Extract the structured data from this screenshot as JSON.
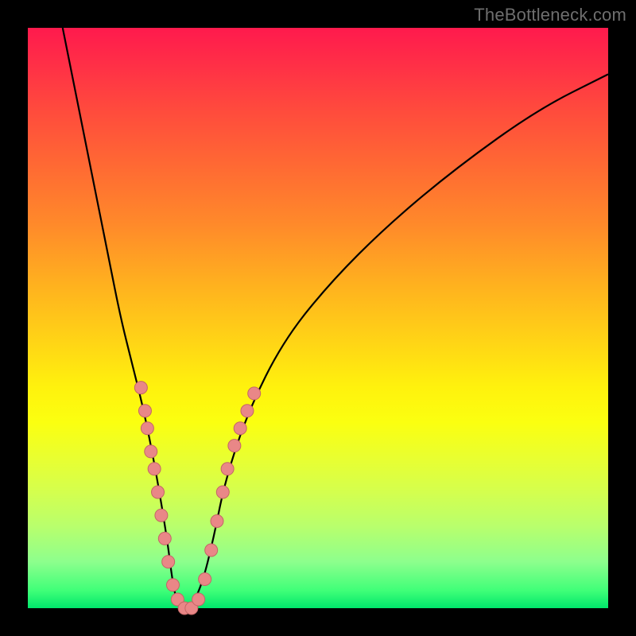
{
  "watermark": "TheBottleneck.com",
  "colors": {
    "background": "#000000",
    "curve": "#000000",
    "dot_fill": "#e98787",
    "dot_stroke": "#c46666"
  },
  "chart_data": {
    "type": "line",
    "title": "",
    "xlabel": "",
    "ylabel": "",
    "xlim": [
      0,
      100
    ],
    "ylim": [
      0,
      100
    ],
    "grid": false,
    "legend": false,
    "series": [
      {
        "name": "bottleneck-curve",
        "x": [
          6,
          8,
          10,
          12,
          14,
          16,
          18,
          20,
          22,
          24,
          25,
          26,
          28,
          30,
          32,
          34,
          38,
          44,
          52,
          62,
          74,
          88,
          100
        ],
        "values": [
          100,
          90,
          80,
          70,
          60,
          50,
          42,
          34,
          24,
          12,
          4,
          0,
          0,
          4,
          12,
          22,
          34,
          46,
          56,
          66,
          76,
          86,
          92
        ]
      }
    ],
    "dots": [
      {
        "x": 19.5,
        "y": 38
      },
      {
        "x": 20.2,
        "y": 34
      },
      {
        "x": 20.6,
        "y": 31
      },
      {
        "x": 21.2,
        "y": 27
      },
      {
        "x": 21.8,
        "y": 24
      },
      {
        "x": 22.4,
        "y": 20
      },
      {
        "x": 23.0,
        "y": 16
      },
      {
        "x": 23.6,
        "y": 12
      },
      {
        "x": 24.2,
        "y": 8
      },
      {
        "x": 25.0,
        "y": 4
      },
      {
        "x": 25.8,
        "y": 1.5
      },
      {
        "x": 27.0,
        "y": 0
      },
      {
        "x": 28.2,
        "y": 0
      },
      {
        "x": 29.4,
        "y": 1.5
      },
      {
        "x": 30.5,
        "y": 5
      },
      {
        "x": 31.6,
        "y": 10
      },
      {
        "x": 32.6,
        "y": 15
      },
      {
        "x": 33.6,
        "y": 20
      },
      {
        "x": 34.4,
        "y": 24
      },
      {
        "x": 35.6,
        "y": 28
      },
      {
        "x": 36.6,
        "y": 31
      },
      {
        "x": 37.8,
        "y": 34
      },
      {
        "x": 39.0,
        "y": 37
      }
    ]
  }
}
